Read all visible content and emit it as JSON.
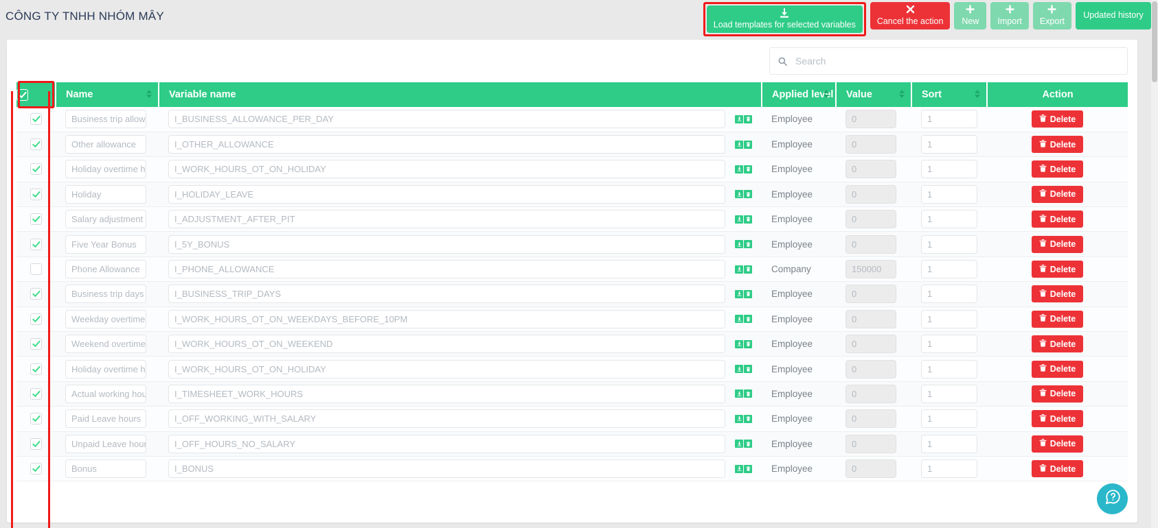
{
  "header": {
    "company_title": "CÔNG TY TNHH NHÓM MÂY",
    "buttons": {
      "load_templates": {
        "label": "Load templates for selected variables",
        "icon": "download-icon",
        "color": "#2ecc87",
        "highlighted": true
      },
      "cancel": {
        "label": "Cancel the action",
        "icon": "close-icon",
        "color": "#ed3237"
      },
      "new": {
        "label": "New",
        "icon": "plus-icon",
        "color": "#7fd9ae"
      },
      "import": {
        "label": "Import",
        "icon": "plus-icon",
        "color": "#7fd9ae"
      },
      "export": {
        "label": "Export",
        "icon": "plus-icon",
        "color": "#7fd9ae"
      },
      "updated_history": {
        "label": "Updated history",
        "color": "#2ecc87"
      }
    }
  },
  "search": {
    "placeholder": "Search",
    "value": "",
    "icon": "search-icon"
  },
  "table": {
    "columns": [
      {
        "key": "check",
        "label": "",
        "sortable": false
      },
      {
        "key": "name",
        "label": "Name",
        "sortable": true
      },
      {
        "key": "variable_name",
        "label": "Variable name",
        "sortable": false
      },
      {
        "key": "applied_level",
        "label": "Applied level",
        "sortable": true
      },
      {
        "key": "value",
        "label": "Value",
        "sortable": true
      },
      {
        "key": "sort",
        "label": "Sort",
        "sortable": true
      },
      {
        "key": "action",
        "label": "Action",
        "sortable": false
      }
    ],
    "header_checkbox_checked": true,
    "delete_label": "Delete",
    "row_icons": {
      "first": "save-icon",
      "second": "trash-icon"
    },
    "rows": [
      {
        "checked": true,
        "name": "Business trip allowance",
        "variable_name": "I_BUSINESS_ALLOWANCE_PER_DAY",
        "applied_level": "Employee",
        "value": "0",
        "sort": "1",
        "action": "Delete"
      },
      {
        "checked": true,
        "name": "Other allowance",
        "variable_name": "I_OTHER_ALLOWANCE",
        "applied_level": "Employee",
        "value": "0",
        "sort": "1",
        "action": "Delete"
      },
      {
        "checked": true,
        "name": "Holiday overtime hours",
        "variable_name": "I_WORK_HOURS_OT_ON_HOLIDAY",
        "applied_level": "Employee",
        "value": "0",
        "sort": "1",
        "action": "Delete"
      },
      {
        "checked": true,
        "name": "Holiday",
        "variable_name": "I_HOLIDAY_LEAVE",
        "applied_level": "Employee",
        "value": "0",
        "sort": "1",
        "action": "Delete"
      },
      {
        "checked": true,
        "name": "Salary adjustment after PIT",
        "variable_name": "I_ADJUSTMENT_AFTER_PIT",
        "applied_level": "Employee",
        "value": "0",
        "sort": "1",
        "action": "Delete"
      },
      {
        "checked": true,
        "name": "Five Year Bonus",
        "variable_name": "I_5Y_BONUS",
        "applied_level": "Employee",
        "value": "0",
        "sort": "1",
        "action": "Delete"
      },
      {
        "checked": false,
        "name": "Phone Allowance",
        "variable_name": "I_PHONE_ALLOWANCE",
        "applied_level": "Company",
        "value": "150000",
        "sort": "1",
        "action": "Delete"
      },
      {
        "checked": true,
        "name": "Business trip days",
        "variable_name": "I_BUSINESS_TRIP_DAYS",
        "applied_level": "Employee",
        "value": "0",
        "sort": "1",
        "action": "Delete"
      },
      {
        "checked": true,
        "name": "Weekday overtime",
        "variable_name": "I_WORK_HOURS_OT_ON_WEEKDAYS_BEFORE_10PM",
        "applied_level": "Employee",
        "value": "0",
        "sort": "1",
        "action": "Delete"
      },
      {
        "checked": true,
        "name": "Weekend overtime",
        "variable_name": "I_WORK_HOURS_OT_ON_WEEKEND",
        "applied_level": "Employee",
        "value": "0",
        "sort": "1",
        "action": "Delete"
      },
      {
        "checked": true,
        "name": "Holiday overtime hours",
        "variable_name": "I_WORK_HOURS_OT_ON_HOLIDAY",
        "applied_level": "Employee",
        "value": "0",
        "sort": "1",
        "action": "Delete"
      },
      {
        "checked": true,
        "name": "Actual working hours",
        "variable_name": "I_TIMESHEET_WORK_HOURS",
        "applied_level": "Employee",
        "value": "0",
        "sort": "1",
        "action": "Delete"
      },
      {
        "checked": true,
        "name": "Paid Leave hours",
        "variable_name": "I_OFF_WORKING_WITH_SALARY",
        "applied_level": "Employee",
        "value": "0",
        "sort": "1",
        "action": "Delete"
      },
      {
        "checked": true,
        "name": "Unpaid Leave hours",
        "variable_name": "I_OFF_HOURS_NO_SALARY",
        "applied_level": "Employee",
        "value": "0",
        "sort": "1",
        "action": "Delete"
      },
      {
        "checked": true,
        "name": "Bonus",
        "variable_name": "I_BONUS",
        "applied_level": "Employee",
        "value": "0",
        "sort": "1",
        "action": "Delete"
      }
    ]
  },
  "help": {
    "icon": "help-chat-icon",
    "color": "#2ab7ca"
  },
  "colors": {
    "accent_green": "#2ecc87",
    "danger_red": "#ed3237",
    "highlight_red": "#f01a1a",
    "soft_green": "#7fd9ae",
    "teal": "#2ab7ca"
  }
}
